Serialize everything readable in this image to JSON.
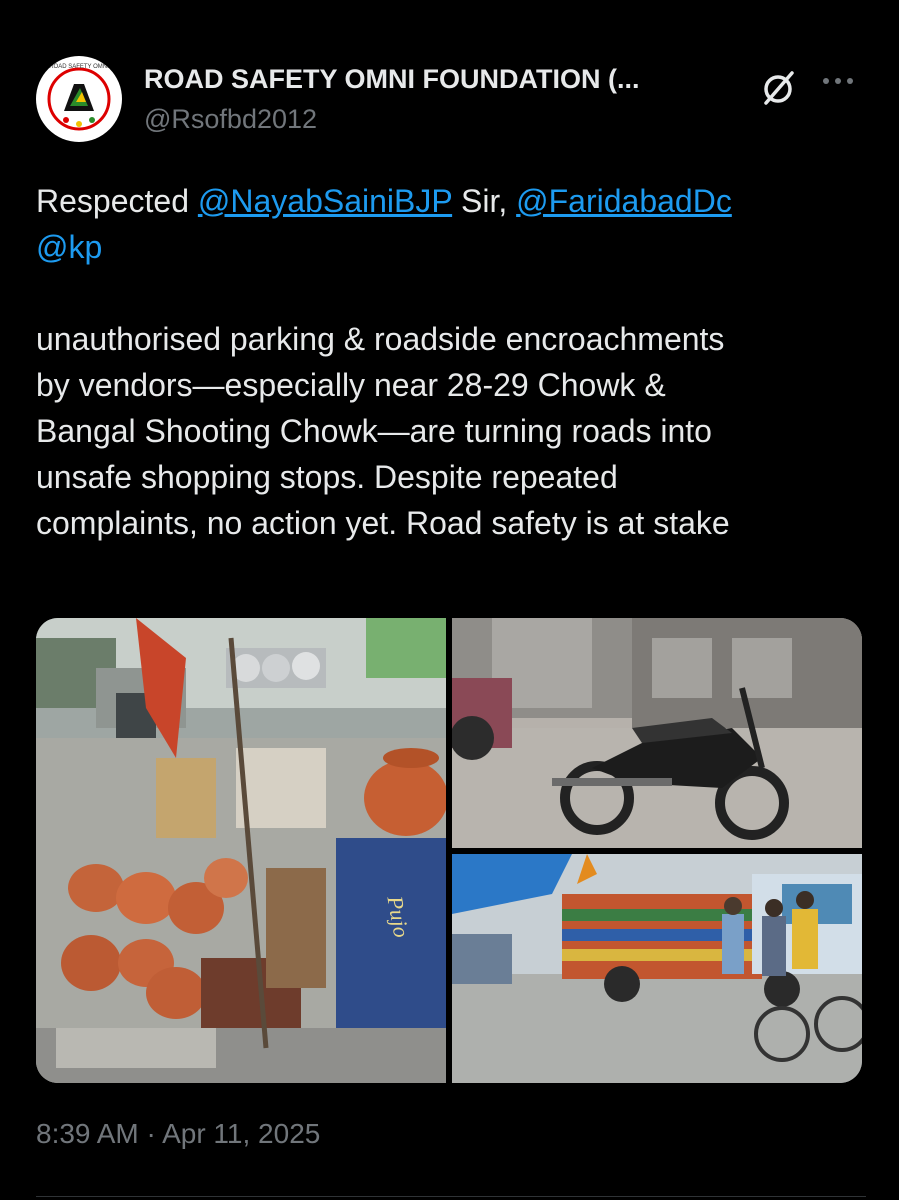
{
  "post": {
    "author_name": "ROAD SAFETY OMNI FOUNDATION (...",
    "author_handle": "@Rsofbd2012",
    "avatar_text": "ROAD SAFETY OMNI FOUNDATION (REGD.)",
    "mentions": [
      "@NayabSainiBJP",
      "@FaridabadDc",
      "@kp"
    ],
    "text_respected": "Respected",
    "text_sir": "Sir,",
    "body_lines": [
      "unauthorised parking & roadside encroachments",
      "by vendors—especially near 28-29 Chowk &",
      "Bangal Shooting Chowk—are turning roads into",
      "unsafe shopping stops. Despite repeated",
      "complaints, no action yet. Road safety is at stake"
    ],
    "timestamp": "8:39 AM · Apr 11, 2025",
    "pot_stand_label": "Pujo"
  },
  "icons": {
    "grok": "grok-icon",
    "more": "more-horizontal-icon"
  },
  "colors": {
    "background": "#000000",
    "text": "#e7e9ea",
    "secondary": "#71767b",
    "link": "#1d9bf0"
  }
}
